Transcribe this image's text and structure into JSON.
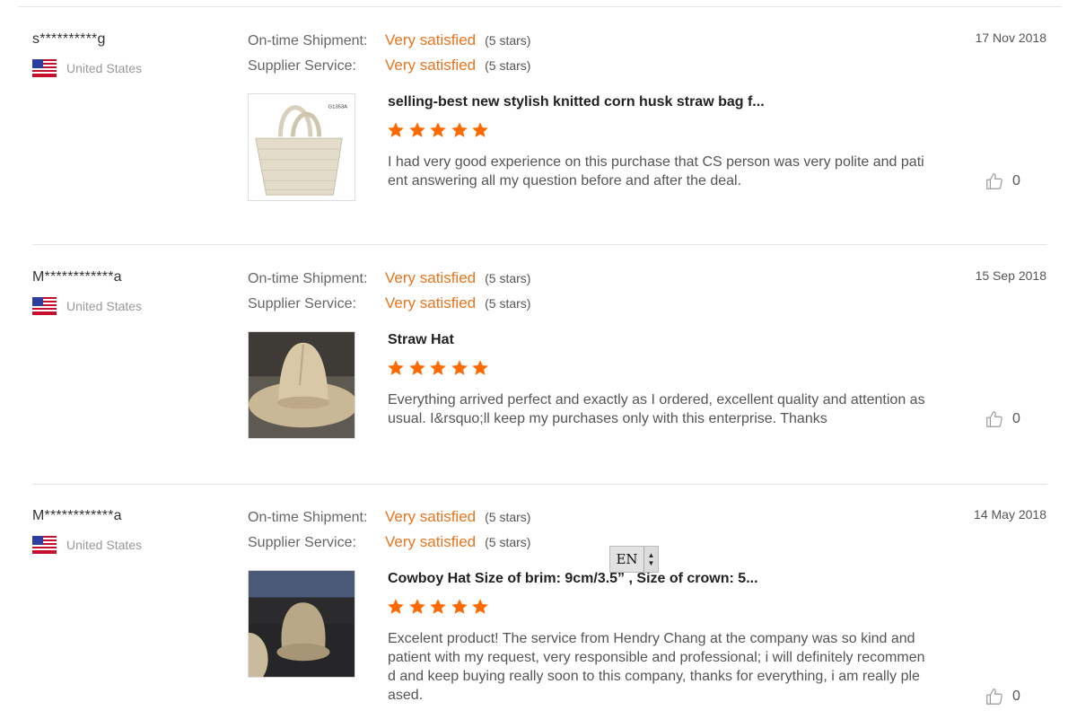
{
  "reviews": [
    {
      "user": "s**********g",
      "country": "United States",
      "shipment_label": "On-time Shipment:",
      "shipment_value": "Very satisfied",
      "shipment_stars": "(5 stars)",
      "service_label": "Supplier Service:",
      "service_value": "Very satisfied",
      "service_stars": "(5 stars)",
      "date": "17 Nov 2018",
      "product_title": "selling-best new stylish knitted corn husk straw bag f...",
      "rating": 5,
      "text": "I had very good experience on this purchase that CS person was very polite and patient answering all my question before and after the deal.",
      "likes": "0",
      "thumb_label": "G1353A"
    },
    {
      "user": "M************a",
      "country": "United States",
      "shipment_label": "On-time Shipment:",
      "shipment_value": "Very satisfied",
      "shipment_stars": "(5 stars)",
      "service_label": "Supplier Service:",
      "service_value": "Very satisfied",
      "service_stars": "(5 stars)",
      "date": "15 Sep 2018",
      "product_title": "Straw Hat",
      "rating": 5,
      "text": "Everything arrived perfect and exactly as I ordered, excellent quality and attention as usual. I&rsquo;ll keep my purchases only with this enterprise. Thanks",
      "likes": "0"
    },
    {
      "user": "M************a",
      "country": "United States",
      "shipment_label": "On-time Shipment:",
      "shipment_value": "Very satisfied",
      "shipment_stars": "(5 stars)",
      "service_label": "Supplier Service:",
      "service_value": "Very satisfied",
      "service_stars": "(5 stars)",
      "date": "14 May 2018",
      "product_title": "Cowboy Hat Size of brim: 9cm/3.5” , Size of crown: 5...",
      "rating": 5,
      "text": "Excelent product! The service from Hendry Chang at the company was so kind and patient with my request, very responsible and professional; i will definitely recommend and keep buying really soon to this company, thanks for everything, i am really pleased.",
      "likes": "0"
    }
  ],
  "language_widget": {
    "code": "EN"
  },
  "colors": {
    "accent": "#e8741e",
    "star": "#ff6a00",
    "divider": "#e6e6e6"
  },
  "icons": [
    "us-flag-icon",
    "star-icon",
    "thumbs-up-icon",
    "language-spinner-icon"
  ]
}
